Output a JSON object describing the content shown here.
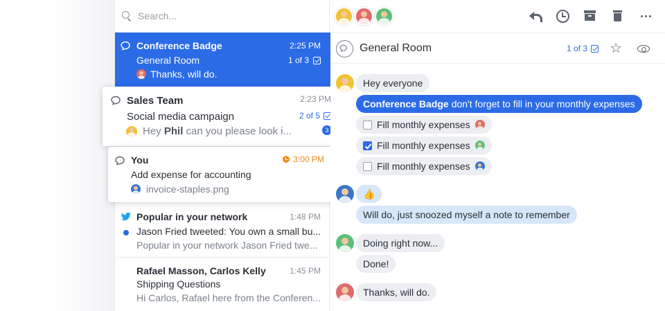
{
  "search": {
    "placeholder": "Search..."
  },
  "conversations": [
    {
      "title": "Conference Badge",
      "time": "2:25 PM",
      "subject": "General Room",
      "counter": "1 of 3",
      "preview": "Thanks, will do."
    },
    {
      "title": "Sales Team",
      "time": "2:23 PM",
      "subject": "Social media campaign",
      "counter": "2 of 5",
      "preview_prefix": "Hey",
      "preview_bold": "Phil",
      "preview_rest": "can you please look i...",
      "badge": "3"
    },
    {
      "title": "You",
      "time": "3:00 PM",
      "subject": "Add expense for accounting",
      "preview": "invoice-staples.png"
    },
    {
      "title": "Popular in your network",
      "time": "1:48 PM",
      "subject": "Jason Fried tweeted: You own a small bu...",
      "preview": "Popular in your network Jason Fried twe..."
    },
    {
      "title": "Rafael Masson, Carlos Kelly",
      "time": "1:45 PM",
      "subject": "Shipping Questions",
      "preview": "Hi Carlos, Rafael here from the Conferen..."
    }
  ],
  "room": {
    "title": "General Room",
    "counter": "1 of 3"
  },
  "messages": {
    "m1": "Hey everyone",
    "m2_bold": "Conference Badge",
    "m2_rest": "don't forget to fill in your monthly expenses",
    "tasks": [
      "Fill monthly expenses",
      "Fill monthly expenses",
      "Fill monthly expenses"
    ],
    "m3": "👍",
    "m4": "Will do, just snoozed myself a note to remember",
    "m5": "Doing right now...",
    "m6": "Done!",
    "m7": "Thanks, will do."
  },
  "colors": {
    "accent": "#2b6be6",
    "snooze": "#ee8a1a",
    "twitter": "#1da1f2"
  }
}
